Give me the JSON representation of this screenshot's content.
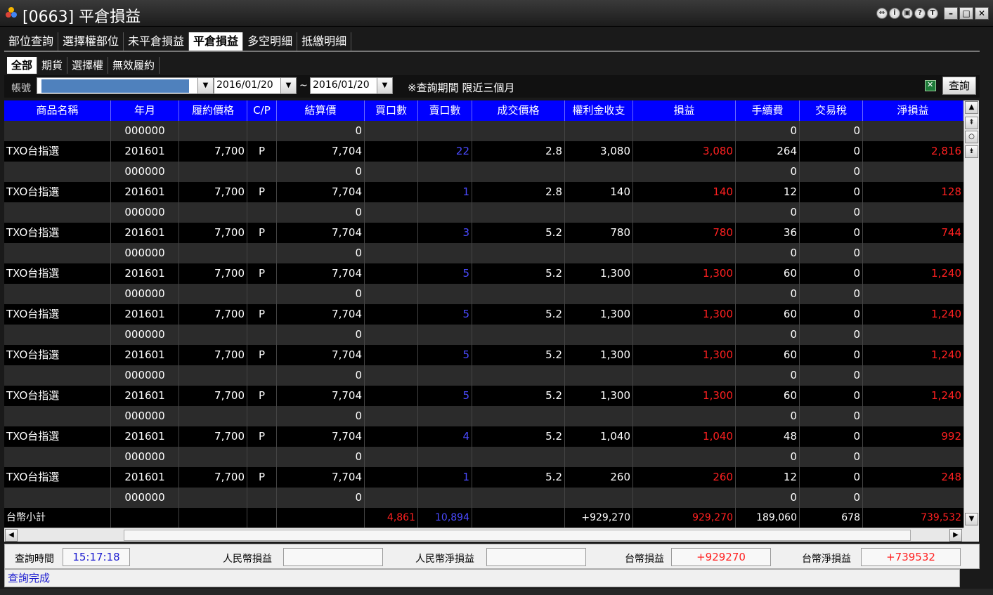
{
  "window": {
    "title": "[0663] 平倉損益"
  },
  "tabs": [
    "部位查詢",
    "選擇權部位",
    "未平倉損益",
    "平倉損益",
    "多空明細",
    "抵繳明細"
  ],
  "subtabs": [
    "全部",
    "期貨",
    "選擇權",
    "無效履約"
  ],
  "query": {
    "account_label": "帳號",
    "date_from": "2016/01/20",
    "date_to": "2016/01/20",
    "tilde": "~",
    "note": "※查詢期間 限近三個月",
    "button": "查詢"
  },
  "table": {
    "headers": [
      "商品名稱",
      "年月",
      "履約價格",
      "C/P",
      "結算價",
      "買口數",
      "賣口數",
      "成交價格",
      "權利金收支",
      "損益",
      "手續費",
      "交易稅",
      "淨損益"
    ],
    "rows": [
      [
        "",
        "000000",
        "",
        "",
        "0",
        "",
        "",
        "",
        "",
        "",
        "0",
        "0",
        ""
      ],
      [
        "TXO台指選",
        "201601",
        "7,700",
        "P",
        "7,704",
        "",
        "22",
        "2.8",
        "3,080",
        "3,080",
        "264",
        "0",
        "2,816"
      ],
      [
        "",
        "000000",
        "",
        "",
        "0",
        "",
        "",
        "",
        "",
        "",
        "0",
        "0",
        ""
      ],
      [
        "TXO台指選",
        "201601",
        "7,700",
        "P",
        "7,704",
        "",
        "1",
        "2.8",
        "140",
        "140",
        "12",
        "0",
        "128"
      ],
      [
        "",
        "000000",
        "",
        "",
        "0",
        "",
        "",
        "",
        "",
        "",
        "0",
        "0",
        ""
      ],
      [
        "TXO台指選",
        "201601",
        "7,700",
        "P",
        "7,704",
        "",
        "3",
        "5.2",
        "780",
        "780",
        "36",
        "0",
        "744"
      ],
      [
        "",
        "000000",
        "",
        "",
        "0",
        "",
        "",
        "",
        "",
        "",
        "0",
        "0",
        ""
      ],
      [
        "TXO台指選",
        "201601",
        "7,700",
        "P",
        "7,704",
        "",
        "5",
        "5.2",
        "1,300",
        "1,300",
        "60",
        "0",
        "1,240"
      ],
      [
        "",
        "000000",
        "",
        "",
        "0",
        "",
        "",
        "",
        "",
        "",
        "0",
        "0",
        ""
      ],
      [
        "TXO台指選",
        "201601",
        "7,700",
        "P",
        "7,704",
        "",
        "5",
        "5.2",
        "1,300",
        "1,300",
        "60",
        "0",
        "1,240"
      ],
      [
        "",
        "000000",
        "",
        "",
        "0",
        "",
        "",
        "",
        "",
        "",
        "0",
        "0",
        ""
      ],
      [
        "TXO台指選",
        "201601",
        "7,700",
        "P",
        "7,704",
        "",
        "5",
        "5.2",
        "1,300",
        "1,300",
        "60",
        "0",
        "1,240"
      ],
      [
        "",
        "000000",
        "",
        "",
        "0",
        "",
        "",
        "",
        "",
        "",
        "0",
        "0",
        ""
      ],
      [
        "TXO台指選",
        "201601",
        "7,700",
        "P",
        "7,704",
        "",
        "5",
        "5.2",
        "1,300",
        "1,300",
        "60",
        "0",
        "1,240"
      ],
      [
        "",
        "000000",
        "",
        "",
        "0",
        "",
        "",
        "",
        "",
        "",
        "0",
        "0",
        ""
      ],
      [
        "TXO台指選",
        "201601",
        "7,700",
        "P",
        "7,704",
        "",
        "4",
        "5.2",
        "1,040",
        "1,040",
        "48",
        "0",
        "992"
      ],
      [
        "",
        "000000",
        "",
        "",
        "0",
        "",
        "",
        "",
        "",
        "",
        "0",
        "0",
        ""
      ],
      [
        "TXO台指選",
        "201601",
        "7,700",
        "P",
        "7,704",
        "",
        "1",
        "5.2",
        "260",
        "260",
        "12",
        "0",
        "248"
      ],
      [
        "",
        "000000",
        "",
        "",
        "0",
        "",
        "",
        "",
        "",
        "",
        "0",
        "0",
        ""
      ]
    ],
    "total": [
      "台幣小計",
      "",
      "",
      "",
      "",
      "4,861",
      "10,894",
      "",
      "+929,270",
      "929,270",
      "189,060",
      "678",
      "739,532"
    ]
  },
  "summary": {
    "query_time_label": "查詢時間",
    "query_time": "15:17:18",
    "rmb_pnl_label": "人民幣損益",
    "rmb_pnl": "",
    "rmb_net_label": "人民幣淨損益",
    "rmb_net": "",
    "twd_pnl_label": "台幣損益",
    "twd_pnl": "+929270",
    "twd_net_label": "台幣淨損益",
    "twd_net": "+739532"
  },
  "status": "查詢完成",
  "colors": {
    "header_blue": "#0000ff",
    "sell_qty": "#4a4aff",
    "profit_red": "#ff2020",
    "status_blue": "#1a1ad0"
  }
}
